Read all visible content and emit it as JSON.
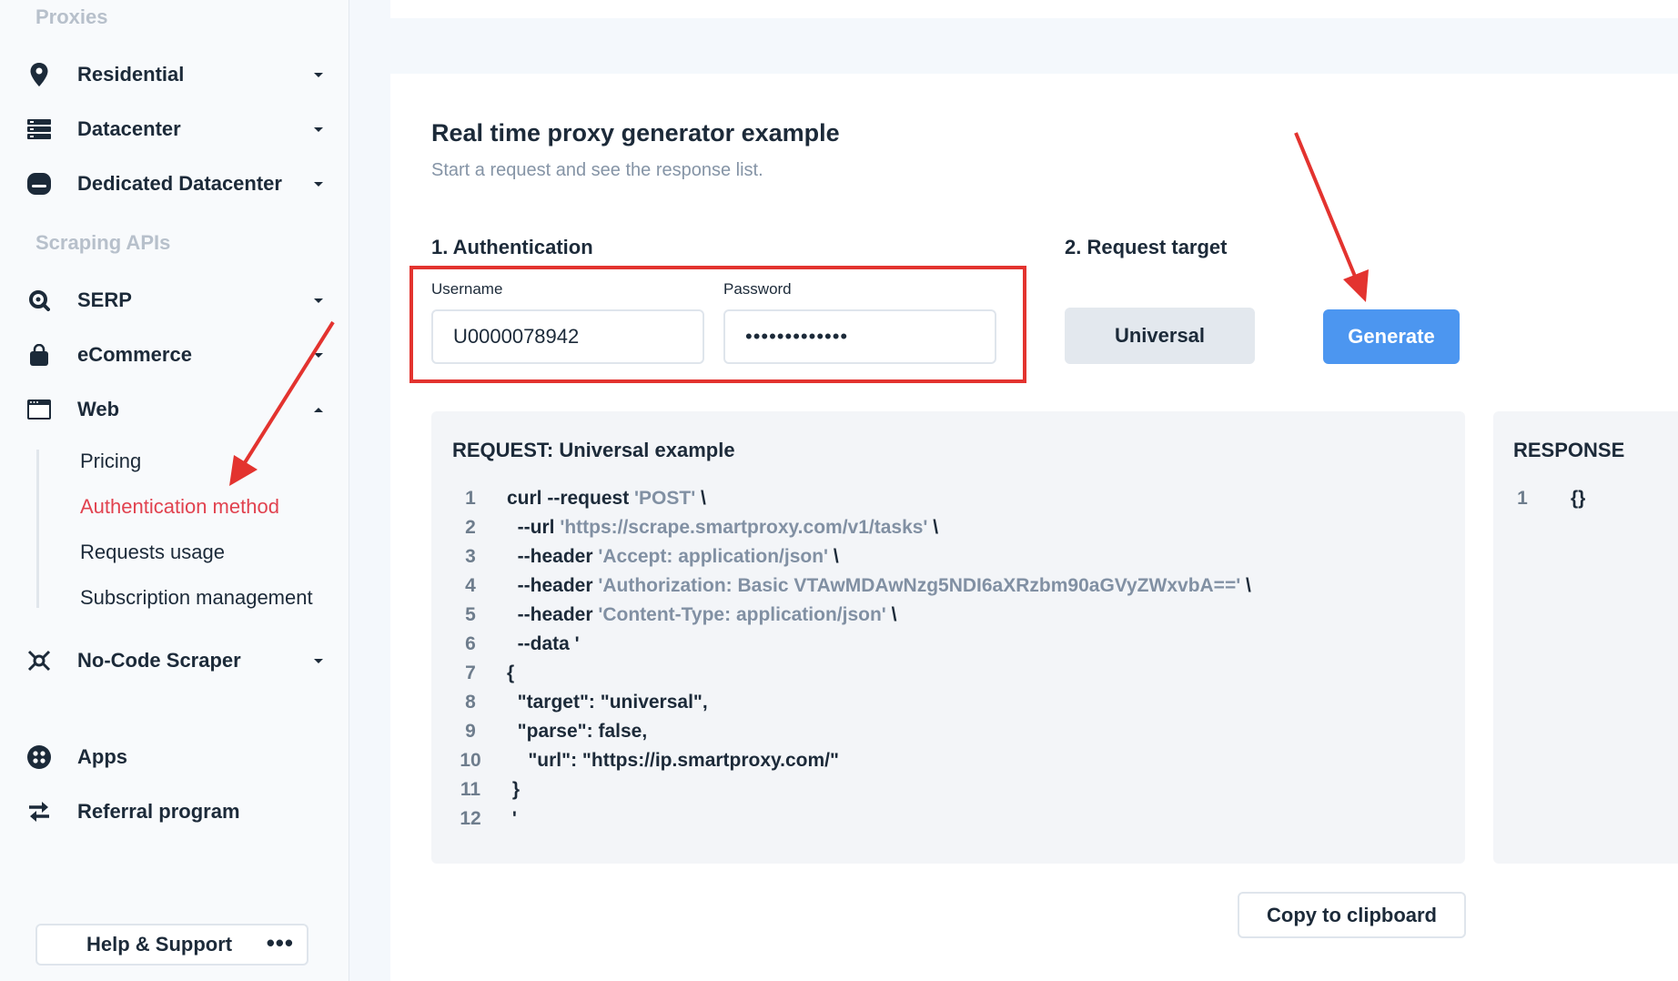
{
  "sidebar": {
    "section_proxies": "Proxies",
    "section_scraping": "Scraping APIs",
    "items": {
      "residential": "Residential",
      "datacenter": "Datacenter",
      "dedicated": "Dedicated Datacenter",
      "serp": "SERP",
      "ecommerce": "eCommerce",
      "web": "Web",
      "nocode": "No-Code Scraper",
      "apps": "Apps",
      "referral": "Referral program"
    },
    "web_sub": {
      "pricing": "Pricing",
      "auth": "Authentication method",
      "usage": "Requests usage",
      "subscription": "Subscription management"
    },
    "help_label": "Help & Support",
    "help_more": "•••"
  },
  "main": {
    "title": "Real time proxy generator example",
    "subtitle": "Start a request and see the response list.",
    "auth_title": "1. Authentication",
    "username_label": "Username",
    "username_value": "U0000078942",
    "password_label": "Password",
    "password_value": "•••••••••••••",
    "target_title": "2. Request target",
    "target_button": "Universal",
    "generate_button": "Generate",
    "request_title": "REQUEST: Universal example",
    "response_title": "RESPONSE",
    "copy_button": "Copy to clipboard"
  },
  "request_code": [
    {
      "n": "1",
      "pre": "curl --request ",
      "str": "'POST'",
      "post": " \\"
    },
    {
      "n": "2",
      "pre": "  --url ",
      "str": "'https://scrape.smartproxy.com/v1/tasks'",
      "post": " \\"
    },
    {
      "n": "3",
      "pre": "  --header ",
      "str": "'Accept: application/json'",
      "post": " \\"
    },
    {
      "n": "4",
      "pre": "  --header ",
      "str": "'Authorization: Basic VTAwMDAwNzg5NDI6aXRzbm90aGVyZWxvbA=='",
      "post": " \\"
    },
    {
      "n": "5",
      "pre": "  --header ",
      "str": "'Content-Type: application/json'",
      "post": " \\"
    },
    {
      "n": "6",
      "pre": "  --data '",
      "str": "",
      "post": ""
    },
    {
      "n": "7",
      "pre": "{",
      "str": "",
      "post": ""
    },
    {
      "n": "8",
      "pre": "  \"target\": \"universal\",",
      "str": "",
      "post": ""
    },
    {
      "n": "9",
      "pre": "  \"parse\": false,",
      "str": "",
      "post": ""
    },
    {
      "n": "10",
      "pre": "    \"url\": \"https://ip.smartproxy.com/\"",
      "str": "",
      "post": ""
    },
    {
      "n": "11",
      "pre": " }",
      "str": "",
      "post": ""
    },
    {
      "n": "12",
      "pre": " '",
      "str": "",
      "post": ""
    }
  ],
  "response_code": [
    {
      "n": "1",
      "pre": "{}",
      "str": "",
      "post": ""
    }
  ],
  "colors": {
    "accent": "#4c96f0",
    "active_link": "#e1424f",
    "annotation": "#e3332f"
  }
}
